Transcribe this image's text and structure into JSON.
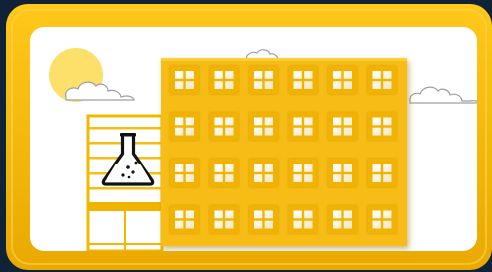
{
  "illustration": {
    "subject": "laboratory-building",
    "icon": "lab-flask-icon",
    "colors": {
      "background_dark": "#0f2236",
      "frame_yellow": "#f6bd0a",
      "frame_yellow_dark": "#d99a00",
      "panel_white": "#ffffff",
      "sun": "#fde06a",
      "building_yellow": "#f7bd12",
      "window_glass": "#fff8e8",
      "cloud_stroke": "#9aa0a8",
      "flask_ink": "#111111"
    },
    "windows": {
      "rows": 4,
      "columns": 6
    },
    "side_wing_stripes": 5,
    "clouds": 3
  }
}
